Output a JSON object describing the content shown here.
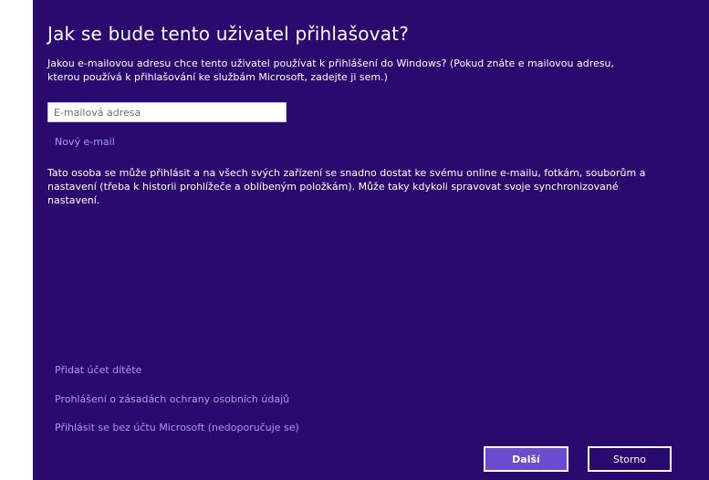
{
  "dialog": {
    "title": "Jak se bude tento uživatel přihlašovat?",
    "description": "Jakou e-mailovou adresu chce tento uživatel používat k přihlášení do Windows? (Pokud znáte e mailovou adresu, kterou používá k přihlašování ke službám Microsoft, zadejte ji sem.)",
    "email_placeholder": "E-mailová adresa",
    "email_value": "",
    "new_email_link": "Nový e-mail",
    "info_text": "Tato osoba se může přihlásit a na všech svých zařízení se snadno dostat ke svému online e-mailu, fotkám, souborům a nastavení (třeba k historii prohlížeče a oblíbeným položkám). Může taky kdykoli spravovat svoje synchronizované nastavení.",
    "footer_links": [
      "Přidat účet dítěte",
      "Prohlášení o zásadách ochrany osobních údajů",
      "Přihlásit se bez účtu Microsoft (nedoporučuje se)"
    ],
    "buttons": {
      "next": "Další",
      "cancel": "Storno"
    }
  },
  "colors": {
    "background": "#2a0a6e",
    "link": "#a89ae6",
    "primary_button": "#6a4bd0",
    "text": "#ffffff"
  }
}
